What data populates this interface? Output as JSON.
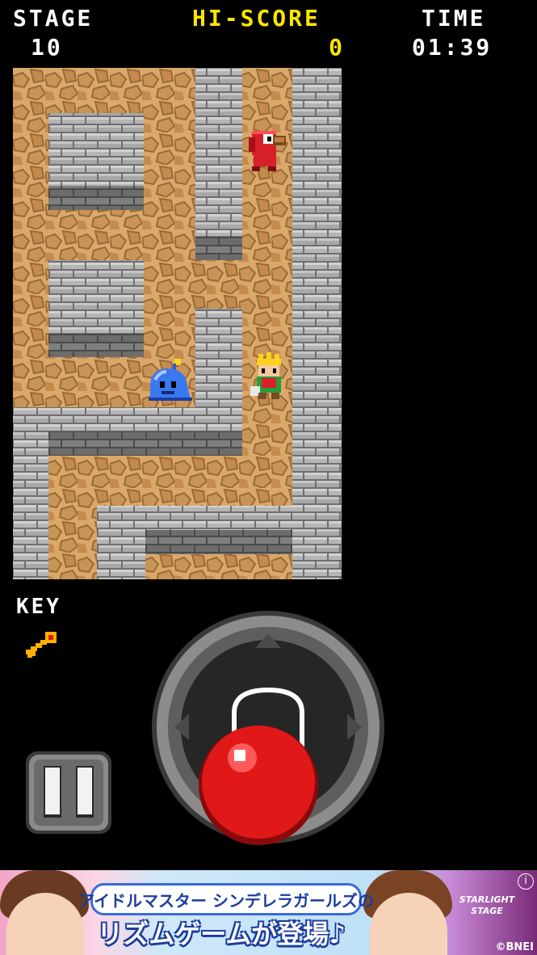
{
  "hud": {
    "stage_label": "STAGE",
    "stage_value": "10",
    "hiscore_label": "HI-SCORE",
    "hiscore_value": "0",
    "time_label": "TIME",
    "time_value": "01:39"
  },
  "colors": {
    "hiscore": "#ffe600",
    "floor": "#d9a86a",
    "wall": "#9a9a9a",
    "joystick_ball": "#e01818"
  },
  "inventory": {
    "key_label": "KEY",
    "key_icon": "golden-key-icon"
  },
  "sprites": {
    "hero": "hero-knight-icon",
    "enemy_slime": "blue-slime-icon",
    "enemy_bird": "red-bird-enemy-icon"
  },
  "controls": {
    "pause_icon": "pause-icon",
    "joystick_icon": "joystick-icon"
  },
  "ad": {
    "title": "アイドルマスター シンデレラガールズの",
    "headline": "リズムゲームが登場♪",
    "sub_logo": "STARLIGHT STAGE",
    "copyright": "©BNEI",
    "info": "i"
  }
}
